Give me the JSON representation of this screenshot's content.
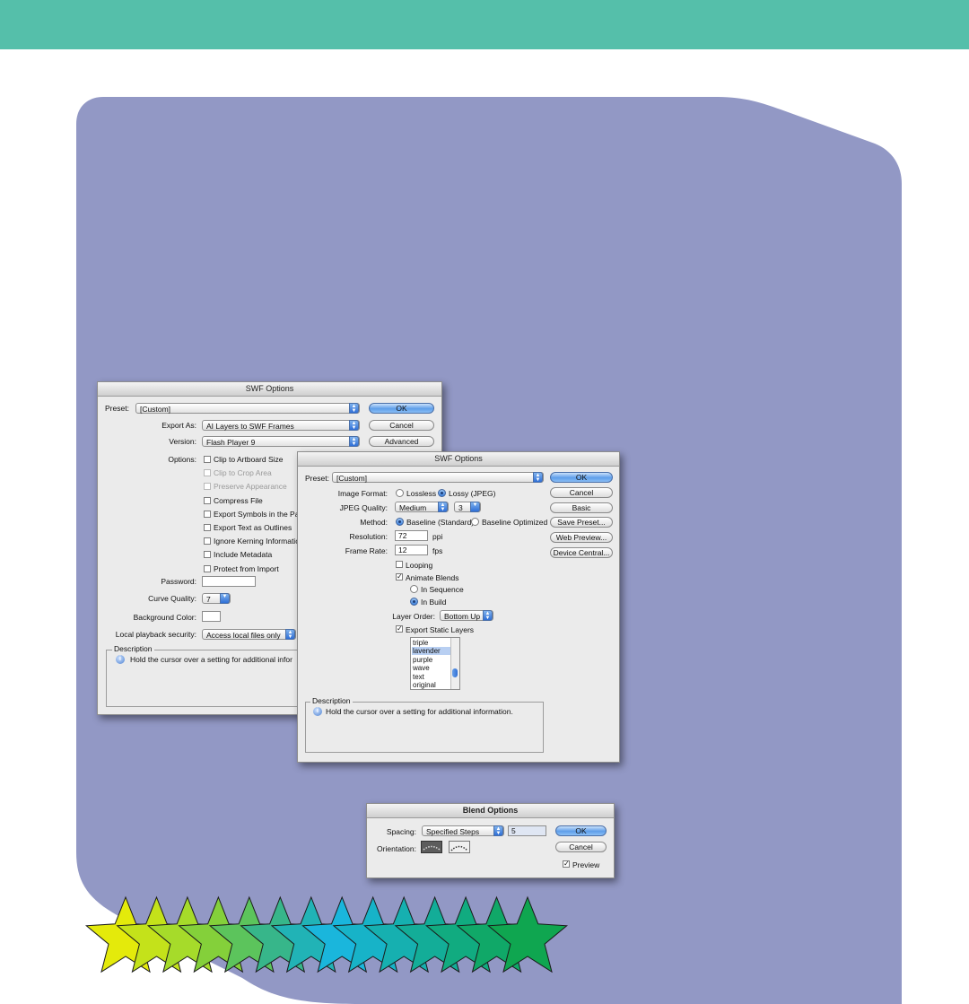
{
  "colors": {
    "top_band": "#55bfaa",
    "card": "#9298c5",
    "window_bg": "#ebebeb",
    "default_button": "#5e9ee9"
  },
  "swf_dialog_advanced": {
    "title": "SWF Options",
    "preset_label": "Preset:",
    "preset_value": "[Custom]",
    "export_as_label": "Export As:",
    "export_as_value": "AI Layers to SWF Frames",
    "version_label": "Version:",
    "version_value": "Flash Player 9",
    "options_label": "Options:",
    "options": [
      {
        "label": "Clip to Artboard Size",
        "checked": false,
        "disabled": false
      },
      {
        "label": "Clip to Crop Area",
        "checked": false,
        "disabled": true
      },
      {
        "label": "Preserve Appearance",
        "checked": false,
        "disabled": true
      },
      {
        "label": "Compress File",
        "checked": false,
        "disabled": false
      },
      {
        "label": "Export Symbols in the Par",
        "checked": false,
        "disabled": false
      },
      {
        "label": "Export Text as Outlines",
        "checked": false,
        "disabled": false
      },
      {
        "label": "Ignore Kerning Informatic",
        "checked": false,
        "disabled": false
      },
      {
        "label": "Include Metadata",
        "checked": false,
        "disabled": false
      },
      {
        "label": "Protect from Import",
        "checked": false,
        "disabled": false
      }
    ],
    "password_label": "Password:",
    "password_value": "",
    "curve_quality_label": "Curve Quality:",
    "curve_quality_value": "7",
    "background_color_label": "Background Color:",
    "local_playback_label": "Local playback security:",
    "local_playback_value": "Access local files only",
    "description_title": "Description",
    "description_text": "Hold the cursor over a setting for additional infor",
    "buttons": {
      "ok": "OK",
      "cancel": "Cancel",
      "advanced": "Advanced"
    }
  },
  "swf_dialog_basic": {
    "title": "SWF Options",
    "preset_label": "Preset:",
    "preset_value": "[Custom]",
    "image_format_label": "Image Format:",
    "image_format_options": [
      "Lossless",
      "Lossy (JPEG)"
    ],
    "image_format_selected": "Lossy (JPEG)",
    "jpeg_quality_label": "JPEG Quality:",
    "jpeg_quality_value": "Medium",
    "jpeg_quality_number": "3",
    "method_label": "Method:",
    "method_options": [
      "Baseline (Standard)",
      "Baseline Optimized"
    ],
    "method_selected": "Baseline (Standard)",
    "resolution_label": "Resolution:",
    "resolution_value": "72",
    "resolution_unit": "ppi",
    "frame_rate_label": "Frame Rate:",
    "frame_rate_value": "12",
    "frame_rate_unit": "fps",
    "looping_label": "Looping",
    "looping_checked": false,
    "animate_blends_label": "Animate Blends",
    "animate_blends_checked": true,
    "blend_mode_options": [
      "In Sequence",
      "In Build"
    ],
    "blend_mode_selected": "In Build",
    "layer_order_label": "Layer Order:",
    "layer_order_value": "Bottom Up",
    "export_static_label": "Export Static Layers",
    "export_static_checked": true,
    "layers": [
      "triple",
      "lavender",
      "purple",
      "wave",
      "text",
      "original"
    ],
    "layers_selected": "lavender",
    "description_title": "Description",
    "description_text": "Hold the cursor over a setting for additional information.",
    "buttons": {
      "ok": "OK",
      "cancel": "Cancel",
      "basic": "Basic",
      "save_preset": "Save Preset...",
      "web_preview": "Web Preview...",
      "device_central": "Device Central..."
    }
  },
  "blend_dialog": {
    "title": "Blend Options",
    "spacing_label": "Spacing:",
    "spacing_value": "Specified Steps",
    "steps_value": "5",
    "orientation_label": "Orientation:",
    "preview_label": "Preview",
    "preview_checked": true,
    "buttons": {
      "ok": "OK",
      "cancel": "Cancel"
    }
  },
  "stars": {
    "count": 14,
    "colors": [
      "#e4ea0b",
      "#c4e21a",
      "#a6db2a",
      "#84d03a",
      "#5cc45c",
      "#37b68a",
      "#21b3b6",
      "#1ab6dc",
      "#17b3c8",
      "#16b0b0",
      "#13ad98",
      "#11ab80",
      "#10a868",
      "#0fa650"
    ]
  }
}
